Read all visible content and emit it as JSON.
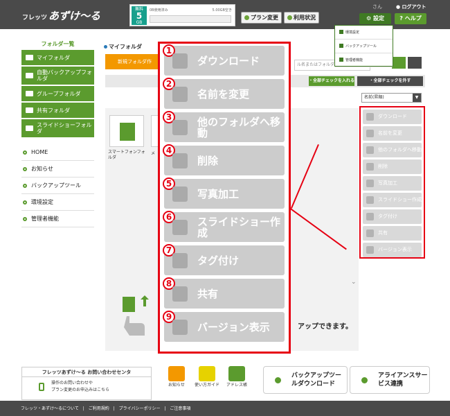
{
  "header": {
    "logo": "あずけ〜る",
    "logo_prefix": "フレッツ",
    "plan_badge_top": "無料",
    "plan_badge_size": "5",
    "plan_badge_unit": "GB",
    "storage_used": "0B使用済み",
    "storage_free": "5.00GB空き",
    "plan_change_label": "プラン変更",
    "usage_label": "利用状況",
    "user_suffix": "さん",
    "logout_label": "ログアウト",
    "settings_label": "設定",
    "help_label": "ヘルプ"
  },
  "settings_dropdown": [
    "環境設定",
    "バックアップツール",
    "管理者機能"
  ],
  "sidebar": {
    "title": "フォルダ一覧",
    "folders": [
      "マイフォルダ",
      "自動バックアップフォルダ",
      "グループフォルダ",
      "共有フォルダ",
      "スライドショーフォルダ"
    ],
    "nav": [
      "HOME",
      "お知らせ",
      "バックアップツール",
      "環境設定",
      "管理者機能"
    ]
  },
  "main": {
    "breadcrumb": "マイフォルダ",
    "new_folder": "新規フォルダ作",
    "search_placeholder": "ル名またはフォルダ名で検",
    "check_all": "・全部チェックを入れる",
    "uncheck_all": "・全部チェックを外す",
    "sort": "名前(昇順)",
    "file_name": "スマートフォンフォルダ",
    "file_name2": "メ",
    "upload_hint": "アップできます。"
  },
  "action_menu": [
    {
      "num": "1",
      "label": "ダウンロード",
      "icon": "download-icon"
    },
    {
      "num": "2",
      "label": "名前を変更",
      "icon": "pencil-icon"
    },
    {
      "num": "3",
      "label": "他のフォルダへ移動",
      "icon": "move-folder-icon"
    },
    {
      "num": "4",
      "label": "削除",
      "icon": "trash-icon"
    },
    {
      "num": "5",
      "label": "写真加工",
      "icon": "camera-icon"
    },
    {
      "num": "6",
      "label": "スライドショー作成",
      "icon": "film-icon"
    },
    {
      "num": "7",
      "label": "タグ付け",
      "icon": "tag-icon"
    },
    {
      "num": "8",
      "label": "共有",
      "icon": "share-icon"
    },
    {
      "num": "9",
      "label": "バージョン表示",
      "icon": "version-icon"
    }
  ],
  "small_action_menu": [
    "ダウンロード",
    "名前を変更",
    "他のフォルダへ移動",
    "削除",
    "写真加工",
    "スライドショー作成",
    "タグ付け",
    "共有",
    "バージョン表示"
  ],
  "footer": {
    "contact_title": "フレッツあずけ〜る お問い合わせセンタ",
    "contact_line1": "操作のお問い合わせや",
    "contact_line2": "プラン変更のお申込みはこちら",
    "icons": [
      "お知らせ",
      "使い方ガイド",
      "アドレス帳"
    ],
    "backup_download": "バックアップツールダウンロード",
    "alliance": "アライアンスサービス連携",
    "links": [
      "フレッツ・あずけ〜るについて",
      "|",
      "ご利用規約",
      "|",
      "プライバシーポリシー",
      "|",
      "ご注意事項"
    ]
  },
  "colors": {
    "accent_green": "#5b9b2e",
    "dark": "#4a4a4a",
    "highlight_red": "#e60012",
    "orange": "#f39800"
  }
}
